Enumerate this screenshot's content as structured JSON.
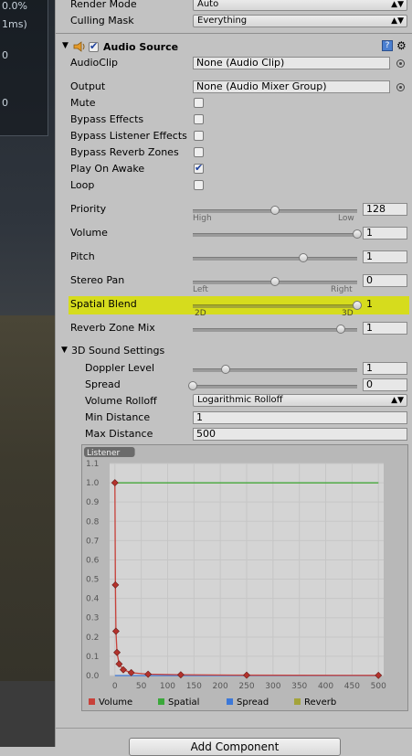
{
  "scene": {
    "stat1": "0.0%",
    "stat2": "1ms)",
    "stat3": "0",
    "stat4": "0"
  },
  "camera": {
    "render_mode_label": "Render Mode",
    "render_mode_value": "Auto",
    "culling_mask_label": "Culling Mask",
    "culling_mask_value": "Everything"
  },
  "audio_source": {
    "title": "Audio Source",
    "enabled": true,
    "audioclip_label": "AudioClip",
    "audioclip_value": "None (Audio Clip)",
    "output_label": "Output",
    "output_value": "None (Audio Mixer Group)",
    "toggles": [
      {
        "label": "Mute",
        "checked": false
      },
      {
        "label": "Bypass Effects",
        "checked": false
      },
      {
        "label": "Bypass Listener Effects",
        "checked": false
      },
      {
        "label": "Bypass Reverb Zones",
        "checked": false
      },
      {
        "label": "Play On Awake",
        "checked": true
      },
      {
        "label": "Loop",
        "checked": false
      }
    ],
    "sliders": {
      "priority": {
        "label": "Priority",
        "value": "128",
        "fraction": 0.5,
        "left": "High",
        "right": "Low"
      },
      "volume": {
        "label": "Volume",
        "value": "1",
        "fraction": 1.0
      },
      "pitch": {
        "label": "Pitch",
        "value": "1",
        "fraction": 0.67
      },
      "stereo_pan": {
        "label": "Stereo Pan",
        "value": "0",
        "fraction": 0.5,
        "left": "Left",
        "right": "Right"
      },
      "spatial_blend": {
        "label": "Spatial Blend",
        "value": "1",
        "fraction": 1.0,
        "left": "2D",
        "right": "3D"
      },
      "reverb_zone_mix": {
        "label": "Reverb Zone Mix",
        "value": "1",
        "fraction": 0.9
      }
    }
  },
  "sound3d": {
    "title": "3D Sound Settings",
    "doppler_label": "Doppler Level",
    "doppler_value": "1",
    "doppler_fraction": 0.2,
    "spread_label": "Spread",
    "spread_value": "0",
    "spread_fraction": 0.0,
    "rolloff_label": "Volume Rolloff",
    "rolloff_value": "Logarithmic Rolloff",
    "min_label": "Min Distance",
    "min_value": "1",
    "max_label": "Max Distance",
    "max_value": "500"
  },
  "chart_data": {
    "type": "line",
    "title": "",
    "badge": "Listener",
    "xlabel": "",
    "ylabel": "",
    "x_ticks": [
      "0",
      "50",
      "100",
      "150",
      "200",
      "250",
      "300",
      "350",
      "400",
      "450",
      "500"
    ],
    "y_ticks": [
      "0.0",
      "0.1",
      "0.2",
      "0.3",
      "0.4",
      "0.5",
      "0.6",
      "0.7",
      "0.8",
      "0.9",
      "1.0",
      "1.1"
    ],
    "xlim": [
      -10,
      510
    ],
    "ylim": [
      0,
      1.1
    ],
    "series": [
      {
        "name": "Volume",
        "color": "#c8413a",
        "points": [
          [
            0,
            1.0
          ],
          [
            1,
            0.47
          ],
          [
            2,
            0.23
          ],
          [
            4,
            0.12
          ],
          [
            8,
            0.06
          ],
          [
            16,
            0.03
          ],
          [
            31,
            0.015
          ],
          [
            63,
            0.007
          ],
          [
            125,
            0.004
          ],
          [
            250,
            0.002
          ],
          [
            500,
            0.001
          ]
        ]
      },
      {
        "name": "Spatial",
        "color": "#3aa83a",
        "points": [
          [
            0,
            1.0
          ],
          [
            500,
            1.0
          ]
        ]
      },
      {
        "name": "Spread",
        "color": "#3c78d8",
        "points": [
          [
            0,
            0.0
          ],
          [
            500,
            0.0
          ]
        ]
      },
      {
        "name": "Reverb",
        "color": "#a3a33a",
        "points": [
          [
            0,
            1.0
          ],
          [
            500,
            1.0
          ]
        ]
      }
    ]
  },
  "footer": {
    "add_component": "Add Component"
  }
}
